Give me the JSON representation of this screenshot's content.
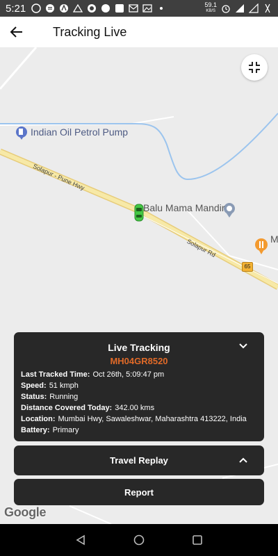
{
  "status_bar": {
    "time": "5:21",
    "net_speed_value": "59.1",
    "net_speed_unit": "KB/S"
  },
  "app_bar": {
    "title": "Tracking Live"
  },
  "map": {
    "poi_petrol": "Indian Oil Petrol Pump",
    "poi_mandir": "Balu Mama Mandir",
    "poi_partial": "M",
    "road_solapur_pune": "Solapur - Pune Hwy",
    "road_solapur_rd": "Solapur Rd",
    "highway_shield": "65",
    "google_logo": "Google"
  },
  "live_tracking": {
    "title": "Live Tracking",
    "vehicle_number": "MH04GR8520",
    "rows": [
      {
        "label": "Last Tracked Time:",
        "value": "Oct 26th, 5:09:47 pm"
      },
      {
        "label": "Speed:",
        "value": "51 kmph"
      },
      {
        "label": "Status:",
        "value": "Running"
      },
      {
        "label": "Distance Covered Today:",
        "value": "342.00 kms"
      },
      {
        "label": "Location:",
        "value": "Mumbai Hwy, Sawaleshwar, Maharashtra 413222, India"
      },
      {
        "label": "Battery:",
        "value": "Primary"
      }
    ]
  },
  "travel_replay": {
    "label": "Travel Replay"
  },
  "report": {
    "label": "Report"
  },
  "colors": {
    "vehicle_number": "#e06a28",
    "card_bg": "#282828",
    "car_marker": "#44c744"
  }
}
